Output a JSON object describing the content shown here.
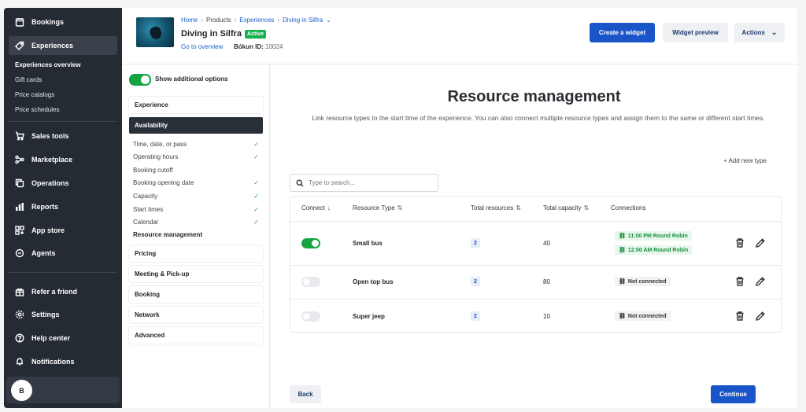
{
  "sidebar": {
    "nav_top": [
      {
        "label": "Bookings",
        "icon": "calendar-icon"
      },
      {
        "label": "Experiences",
        "icon": "tag-icon"
      }
    ],
    "sub_items": [
      "Experiences overview",
      "Gift cards",
      "Price catalogs",
      "Price schedules"
    ],
    "nav_mid": [
      {
        "label": "Sales tools",
        "icon": "cart-icon"
      },
      {
        "label": "Marketplace",
        "icon": "network-icon"
      },
      {
        "label": "Operations",
        "icon": "copy-icon"
      },
      {
        "label": "Reports",
        "icon": "bar-chart-icon"
      },
      {
        "label": "App store",
        "icon": "grid-icon"
      },
      {
        "label": "Agents",
        "icon": "chat-icon"
      }
    ],
    "nav_bottom": [
      {
        "label": "Refer a friend",
        "icon": "gift-icon"
      },
      {
        "label": "Settings",
        "icon": "gear-icon"
      },
      {
        "label": "Help center",
        "icon": "help-icon"
      },
      {
        "label": "Notifications",
        "icon": "bell-icon"
      }
    ],
    "avatar_initial": "B"
  },
  "header": {
    "breadcrumb": [
      "Home",
      "Products",
      "Experiences",
      "Diving in Silfra"
    ],
    "title": "Diving in Silfra",
    "status": "Active",
    "go_to_overview": "Go to overview",
    "bokun_id_label": "Bókun ID:",
    "bokun_id_value": "10024",
    "create_widget": "Create a widget",
    "widget_preview": "Widget preview",
    "actions": "Actions"
  },
  "left_panel": {
    "show_options_label": "Show additional options",
    "show_options_on": true,
    "sections": [
      "Experience",
      "Availability",
      "Pricing",
      "Meeting & Pick-up",
      "Booking",
      "Network",
      "Advanced"
    ],
    "availability_steps": [
      {
        "label": "Time, date, or pass",
        "done": true
      },
      {
        "label": "Operating hours",
        "done": true
      },
      {
        "label": "Booking cutoff",
        "done": false
      },
      {
        "label": "Booking opening date",
        "done": true
      },
      {
        "label": "Capacity",
        "done": true
      },
      {
        "label": "Start times",
        "done": true
      },
      {
        "label": "Calendar",
        "done": true
      },
      {
        "label": "Resource management",
        "done": false
      }
    ]
  },
  "main": {
    "title": "Resource management",
    "description": "Link resource types to the start time of the experience. You can also connect multiple resource types and assign them to the same or different start times.",
    "add_new_type": "Add new type",
    "search_placeholder": "Type to search...",
    "columns": [
      "Connect",
      "Resource Type",
      "Total resources",
      "Total capacity",
      "Connections"
    ],
    "rows": [
      {
        "connected": true,
        "type": "Small bus",
        "resources": "2",
        "capacity": "40",
        "connections": [
          "11:00 PM Round Robin",
          "12:00 AM Round Robin"
        ]
      },
      {
        "connected": false,
        "type": "Open top bus",
        "resources": "2",
        "capacity": "80",
        "connections": [
          "Not connected"
        ]
      },
      {
        "connected": false,
        "type": "Super jeep",
        "resources": "2",
        "capacity": "10",
        "connections": [
          "Not connected"
        ]
      }
    ],
    "back": "Back",
    "continue": "Continue"
  }
}
